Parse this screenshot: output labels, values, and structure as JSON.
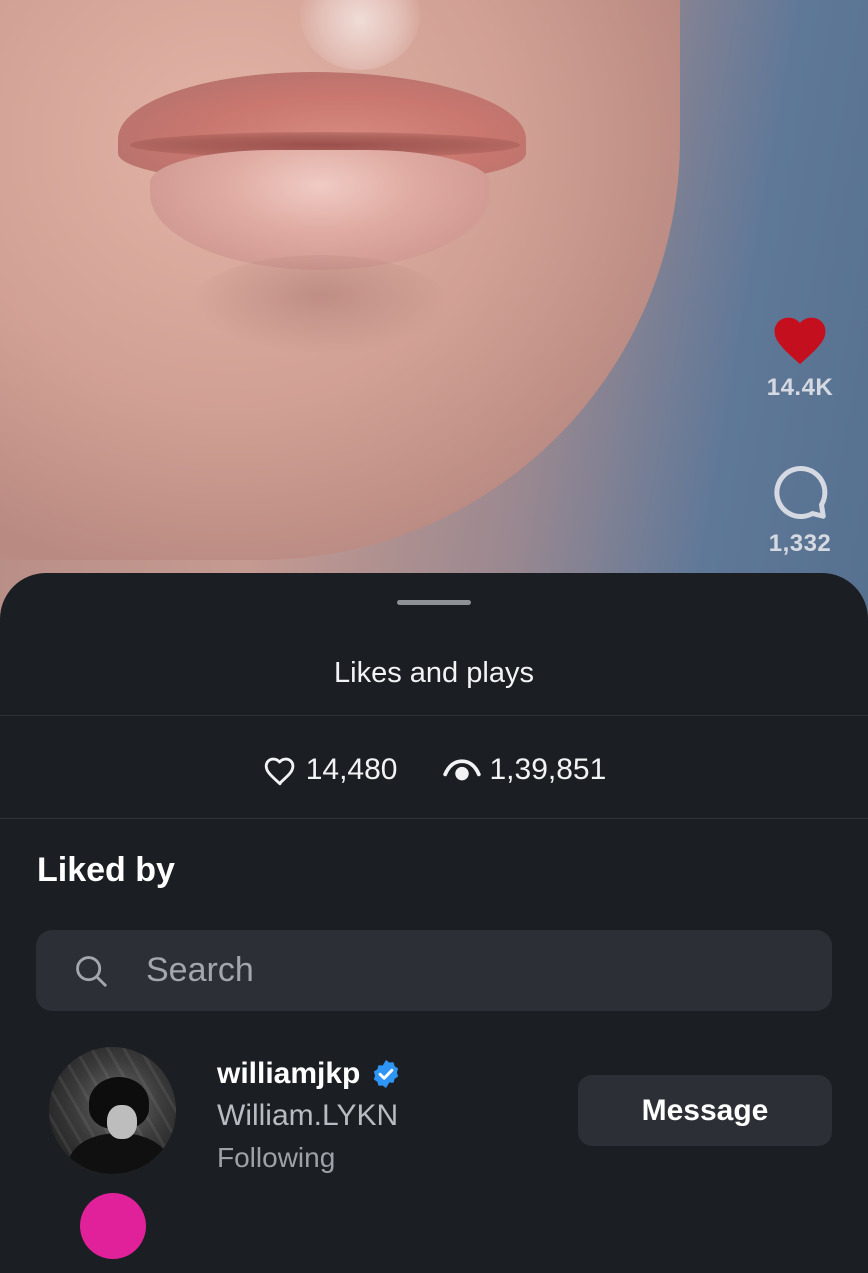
{
  "video": {
    "like_count": "14.4K",
    "comment_count": "1,332",
    "like_color": "#c4101e"
  },
  "sheet": {
    "title": "Likes and plays",
    "stats": {
      "likes": "14,480",
      "plays": "1,39,851"
    },
    "section_heading": "Liked by",
    "search": {
      "placeholder": "Search",
      "value": ""
    },
    "users": [
      {
        "username": "williamjkp",
        "verified": true,
        "display_name": "William.LYKN",
        "status": "Following",
        "action_label": "Message"
      }
    ]
  },
  "colors": {
    "sheet_background": "#1b1e22",
    "field_background": "#2c3036",
    "verified_badge": "#2f95f5",
    "next_avatar": "#e0219a"
  }
}
